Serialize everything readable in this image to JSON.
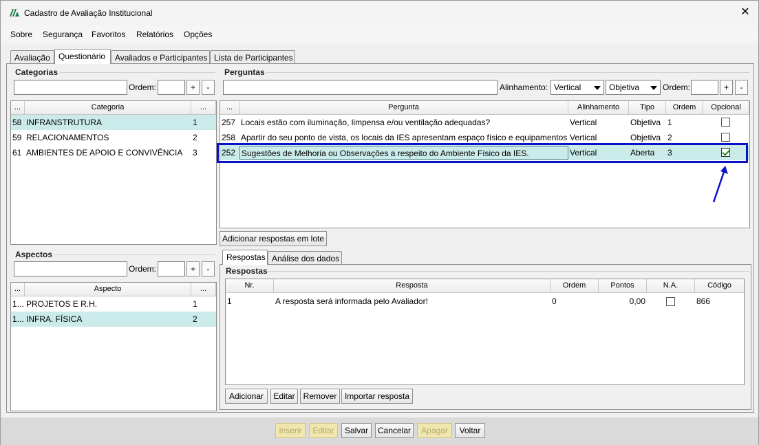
{
  "window": {
    "title": "Cadastro de Avaliação Institucional",
    "close_glyph": "✕",
    "logo_icon": "app-logo-icon"
  },
  "menu": [
    "Sobre",
    "Segurança",
    "Favoritos",
    "Relatórios",
    "Opções"
  ],
  "tabs": [
    "Avaliação",
    "Questionário",
    "Avaliados e Participantes",
    "Lista de Participantes"
  ],
  "categorias": {
    "label": "Categorias",
    "input_value": "",
    "ordem_label": "Ordem:",
    "ordem_value": "",
    "plus": "+",
    "minus": "-",
    "columns": [
      "...",
      "Categoria",
      "..."
    ],
    "rows": [
      {
        "id": "58",
        "name": "INFRANSTRUTURA",
        "ordem": "1",
        "selected": true
      },
      {
        "id": "59",
        "name": "RELACIONAMENTOS",
        "ordem": "2",
        "selected": false
      },
      {
        "id": "61",
        "name": "AMBIENTES DE APOIO E CONVIVÊNCIA",
        "ordem": "3",
        "selected": false
      }
    ]
  },
  "aspectos": {
    "label": "Aspectos",
    "input_value": "",
    "ordem_label": "Ordem:",
    "ordem_value": "",
    "plus": "+",
    "minus": "-",
    "columns": [
      "...",
      "Aspecto",
      "..."
    ],
    "rows": [
      {
        "id": "1...",
        "name": "PROJETOS E R.H.",
        "ordem": "1",
        "selected": false
      },
      {
        "id": "1...",
        "name": "INFRA. FÍSICA",
        "ordem": "2",
        "selected": true
      }
    ]
  },
  "perguntas": {
    "label": "Perguntas",
    "input_value": "",
    "alinhamento_label": "Alinhamento:",
    "alinhamento_value": "Vertical",
    "tipo_value": "Objetiva",
    "ordem_label": "Ordem:",
    "ordem_value": "",
    "plus": "+",
    "minus": "-",
    "columns": [
      "...",
      "Pergunta",
      "Alinhamento",
      "Tipo",
      "Ordem",
      "Opcional"
    ],
    "rows": [
      {
        "id": "257",
        "text": " Locais estão com iluminação, limpensa e/ou ventilação adequadas?",
        "alinhamento": "Vertical",
        "tipo": "Objetiva",
        "ordem": "1",
        "opcional": false,
        "selected": false
      },
      {
        "id": "258",
        "text": "Apartir do seu ponto de vista, os locais da IES apresentam espaço físico e equipamentos ...",
        "alinhamento": "Vertical",
        "tipo": "Objetiva",
        "ordem": "2",
        "opcional": false,
        "selected": false
      },
      {
        "id": "252",
        "text": "Sugestões de Melhoria ou Observações a respeito do Ambiente Físico da IES.",
        "alinhamento": "Vertical",
        "tipo": "Aberta",
        "ordem": "3",
        "opcional": true,
        "selected": true
      }
    ],
    "lote_button": "Adicionar respostas em lote"
  },
  "subtabs": [
    "Respostas",
    "Análise dos dados"
  ],
  "respostas": {
    "label": "Respostas",
    "columns": [
      "Nr.",
      "Resposta",
      "Ordem",
      "Pontos",
      "N.A.",
      "Código"
    ],
    "rows": [
      {
        "nr": "1",
        "resposta": "A resposta será informada pelo Avaliador!",
        "ordem": "0",
        "pontos": "0,00",
        "na": false,
        "codigo": "866"
      }
    ],
    "buttons": [
      "Adicionar",
      "Editar",
      "Remover",
      "Importar resposta"
    ]
  },
  "footer_buttons": [
    {
      "label": "Inserir",
      "enabled": false
    },
    {
      "label": "Editar",
      "enabled": false
    },
    {
      "label": "Salvar",
      "enabled": true
    },
    {
      "label": "Cancelar",
      "enabled": true
    },
    {
      "label": "Apagar",
      "enabled": false
    },
    {
      "label": "Voltar",
      "enabled": true
    }
  ],
  "colors": {
    "highlight": "#0a12c8",
    "selection": "#cbeaea",
    "check": "#1a8c1a"
  }
}
